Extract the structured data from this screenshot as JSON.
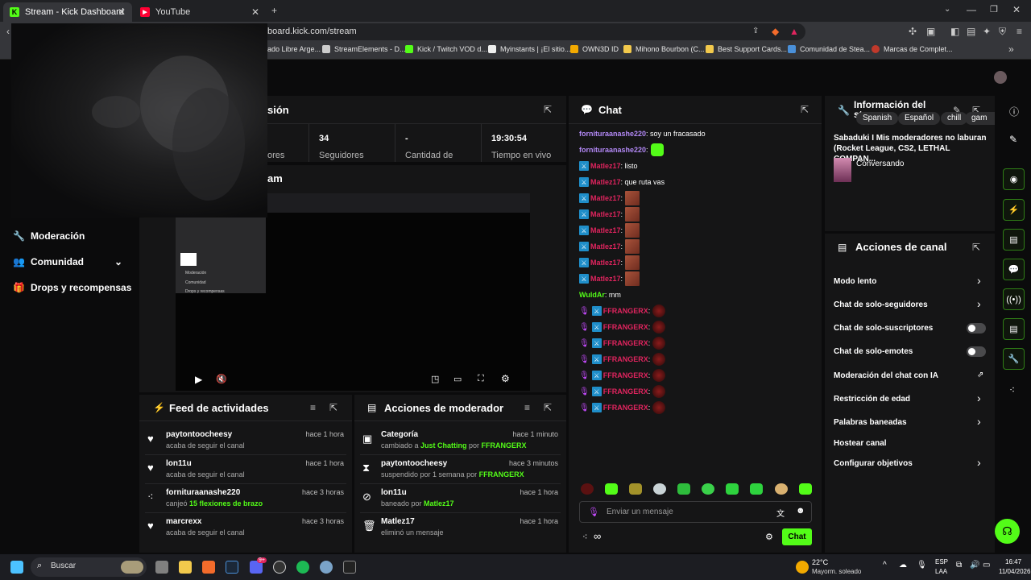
{
  "browser": {
    "tabs": [
      {
        "title": "Stream - Kick Dashboard",
        "active": true
      },
      {
        "title": "YouTube",
        "active": false
      }
    ],
    "url": "board.kick.com/stream",
    "bookmarks": [
      "ado Libre Arge...",
      "StreamElements - D...",
      "Kick / Twitch VOD d...",
      "Myinstants | ¡El sitio...",
      "OWN3D ID",
      "Mihono Bourbon (C...",
      "Best Support Cards...",
      "Comunidad de Stea...",
      "Marcas de Complet..."
    ]
  },
  "sidebar": {
    "items": [
      {
        "label": "Moderación",
        "icon": "wrench-icon"
      },
      {
        "label": "Comunidad",
        "icon": "people-icon"
      },
      {
        "label": "Drops y recompensas",
        "icon": "gift-icon"
      }
    ]
  },
  "session": {
    "title_fragment": "sión",
    "stats": [
      {
        "value": "",
        "label": "ores"
      },
      {
        "value": "34",
        "label": "Seguidores"
      },
      {
        "value": "-",
        "label": "Cantidad de"
      },
      {
        "value": "19:30:54",
        "label": "Tiempo en vivo"
      }
    ]
  },
  "preview": {
    "title_fragment": "am",
    "mini_nav": [
      "Moderación",
      "Comunidad",
      "Drops y recompensas"
    ]
  },
  "activity_feed": {
    "title": "Feed de actividades",
    "items": [
      {
        "name": "paytontoocheesy",
        "sub": "acaba de seguir el canal",
        "highlight": "",
        "time": "hace 1 hora",
        "icon": "heart-icon"
      },
      {
        "name": "lon11u",
        "sub": "acaba de seguir el canal",
        "highlight": "",
        "time": "hace 1 hora",
        "icon": "heart-icon"
      },
      {
        "name": "fornituraanashe220",
        "sub": "canjeó",
        "highlight": "15 flexiones de brazo",
        "time": "hace 3 horas",
        "icon": "points-icon"
      },
      {
        "name": "marcrexx",
        "sub": "acaba de seguir el canal",
        "highlight": "",
        "time": "hace 3 horas",
        "icon": "heart-icon"
      }
    ]
  },
  "mod_actions": {
    "title": "Acciones de moderador",
    "items": [
      {
        "name": "Categoría",
        "sub_pre": "cambiado a",
        "hl1": "Just Chatting",
        "mid": "por",
        "hl2": "FFRANGERX",
        "time": "hace 1 minuto",
        "icon": "category-icon"
      },
      {
        "name": "paytontoocheesy",
        "sub_pre": "suspendido por 1 semana por",
        "hl1": "FFRANGERX",
        "mid": "",
        "hl2": "",
        "time": "hace 3 minutos",
        "icon": "hourglass-icon"
      },
      {
        "name": "lon11u",
        "sub_pre": "baneado por",
        "hl1": "Matlez17",
        "mid": "",
        "hl2": "",
        "time": "hace 1 hora",
        "icon": "ban-icon"
      },
      {
        "name": "Matlez17",
        "sub_pre": "eliminó un mensaje",
        "hl1": "",
        "mid": "",
        "hl2": "",
        "time": "hace 1 hora",
        "icon": "trash-icon"
      }
    ]
  },
  "chat": {
    "title": "Chat",
    "input_placeholder": "Enviar un mensaje",
    "send_label": "Chat",
    "colors": {
      "purple": "#b288f5",
      "red": "#e0245e",
      "green": "#53fc18"
    },
    "messages": [
      {
        "user": "fornituraanashe220",
        "text": ": soy un fracasado",
        "color": "#b288f5",
        "badges": [],
        "emote": ""
      },
      {
        "user": "fornituraanashe220",
        "text": ":",
        "color": "#b288f5",
        "badges": [],
        "emote": "green"
      },
      {
        "user": "Matlez17",
        "text": ": listo",
        "color": "#e0245e",
        "badges": [
          "mod"
        ],
        "emote": ""
      },
      {
        "user": "Matlez17",
        "text": ": que ruta vas",
        "color": "#e0245e",
        "badges": [
          "mod"
        ],
        "emote": ""
      },
      {
        "user": "Matlez17",
        "text": ":",
        "color": "#e0245e",
        "badges": [
          "mod"
        ],
        "emote": "meme"
      },
      {
        "user": "Matlez17",
        "text": ":",
        "color": "#e0245e",
        "badges": [
          "mod"
        ],
        "emote": "meme"
      },
      {
        "user": "Matlez17",
        "text": ":",
        "color": "#e0245e",
        "badges": [
          "mod"
        ],
        "emote": "meme"
      },
      {
        "user": "Matlez17",
        "text": ":",
        "color": "#e0245e",
        "badges": [
          "mod"
        ],
        "emote": "meme"
      },
      {
        "user": "Matlez17",
        "text": ":",
        "color": "#e0245e",
        "badges": [
          "mod"
        ],
        "emote": "meme"
      },
      {
        "user": "Matlez17",
        "text": ":",
        "color": "#e0245e",
        "badges": [
          "mod"
        ],
        "emote": "meme"
      },
      {
        "user": "WuldAr",
        "text": ": mm",
        "color": "#53fc18",
        "badges": [],
        "emote": ""
      },
      {
        "user": "FFRANGERX",
        "text": ":",
        "color": "#e0245e",
        "badges": [
          "mic",
          "mod"
        ],
        "emote": "red"
      },
      {
        "user": "FFRANGERX",
        "text": ":",
        "color": "#e0245e",
        "badges": [
          "mic",
          "mod"
        ],
        "emote": "red"
      },
      {
        "user": "FFRANGERX",
        "text": ":",
        "color": "#e0245e",
        "badges": [
          "mic",
          "mod"
        ],
        "emote": "red"
      },
      {
        "user": "FFRANGERX",
        "text": ":",
        "color": "#e0245e",
        "badges": [
          "mic",
          "mod"
        ],
        "emote": "red"
      },
      {
        "user": "FFRANGERX",
        "text": ":",
        "color": "#e0245e",
        "badges": [
          "mic",
          "mod"
        ],
        "emote": "red"
      },
      {
        "user": "FFRANGERX",
        "text": ":",
        "color": "#e0245e",
        "badges": [
          "mic",
          "mod"
        ],
        "emote": "red"
      },
      {
        "user": "FFRANGERX",
        "text": ":",
        "color": "#e0245e",
        "badges": [
          "mic",
          "mod"
        ],
        "emote": "red"
      }
    ]
  },
  "stream_info": {
    "title": "Información del stream",
    "stream_title": "Sabaduki I Mis moderadores no laburan (Rocket League, CS2, LETHAL COMPAN...",
    "category": "Conversando",
    "tags": [
      "Spanish",
      "Español",
      "chill",
      "gam"
    ]
  },
  "channel_actions": {
    "title": "Acciones de canal",
    "items": [
      {
        "label": "Modo lento",
        "control": "chevron"
      },
      {
        "label": "Chat de solo-seguidores",
        "control": "chevron"
      },
      {
        "label": "Chat de solo-suscriptores",
        "control": "toggle"
      },
      {
        "label": "Chat de solo-emotes",
        "control": "toggle"
      },
      {
        "label": "Moderación del chat con IA",
        "control": "external"
      },
      {
        "label": "Restricción de edad",
        "control": "chevron"
      },
      {
        "label": "Palabras baneadas",
        "control": "chevron"
      },
      {
        "label": "Hostear canal",
        "control": "none"
      },
      {
        "label": "Configurar objetivos",
        "control": "chevron"
      }
    ]
  },
  "taskbar": {
    "search_label": "Buscar",
    "weather_temp": "22°C",
    "weather_desc": "Mayorm. soleado",
    "lang": "ESP",
    "lang2": "LAA",
    "time": "16:47",
    "date": "11/04/2026",
    "discord_badge": "9+"
  }
}
